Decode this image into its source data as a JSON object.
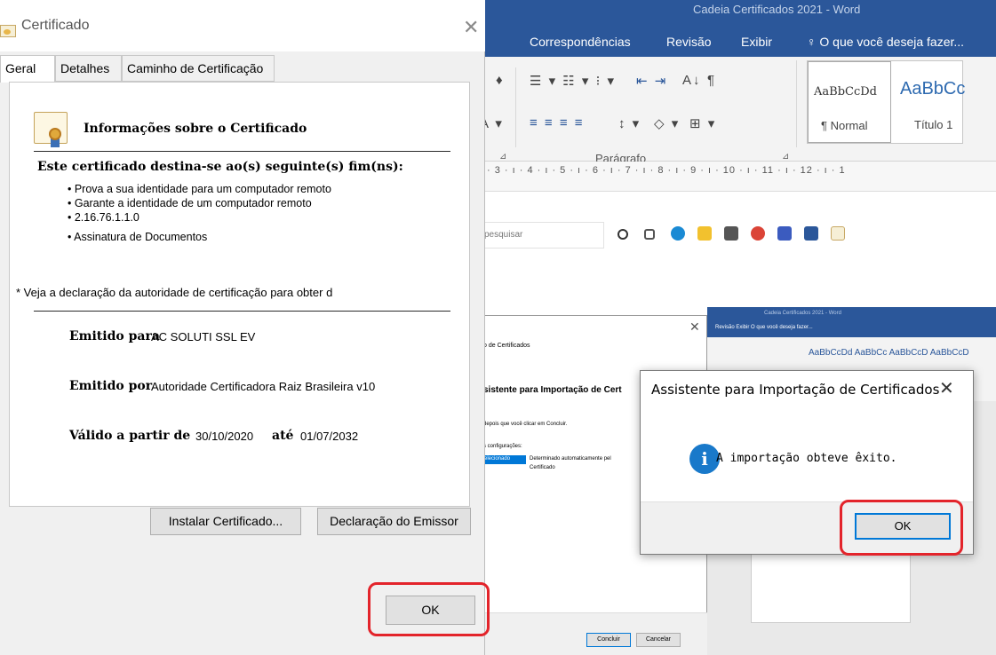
{
  "word": {
    "title": "Cadeia Certificados 2021 - Word",
    "menu": [
      "Correspondências",
      "Revisão",
      "Exibir"
    ],
    "tell_me": "O que você deseja fazer...",
    "ribbon_row1_glyphs": "☰ ▾ ☷ ▾ ⁝ ▾",
    "ribbon_row2_glyphs": "≡ ≡ ≡ ≡",
    "paragraph_group": "Parágrafo",
    "styles": [
      {
        "sample": "AaBbCcDd",
        "name": "¶ Normal"
      },
      {
        "sample": "AaBbCc",
        "name": "Título 1"
      }
    ],
    "ruler": "· 3 · ı · 4 · ı · 5 · ı · 6 · ı · 7 · ı · 8 · ı · 9 · ı · 10 · ı · 11 · ı · 12 · ı · 1",
    "taskbar_search": "pesquisar"
  },
  "inner_screenshot": {
    "word_title": "Cadeia Certificados 2021 - Word",
    "word_menu": "Revisão   Exibir   O que você deseja fazer...",
    "styles": "AaBbCcDd  AaBbCc  AaBbCcD  AaBbCcD",
    "wizard_subtitle": "o de Certificados",
    "wizard_title": "sistente para Importação de Cert",
    "wizard_hint": "depois que você clicar em Concluir.",
    "wizard_config": "s configurações:",
    "wizard_selected": "Selecionado",
    "wizard_detected": "Determinado automaticamente pel",
    "wizard_cert": "Certificado",
    "concluir": "Concluir",
    "cancelar": "Cancelar"
  },
  "success_dialog": {
    "title": "Assistente para Importação de Certificados",
    "close": "✕",
    "info_icon": "i",
    "message": "A importação obteve êxito.",
    "ok": "OK"
  },
  "cert_dialog": {
    "title": "Certificado",
    "close": "✕",
    "tabs": [
      "Geral",
      "Detalhes",
      "Caminho de Certificação"
    ],
    "info_heading": "Informações sobre o Certificado",
    "purpose_heading": "Este certificado destina-se ao(s) seguinte(s) fim(ns):",
    "purposes": [
      "• Prova a sua identidade para um computador remoto",
      "• Garante a identidade de um computador remoto",
      "• 2.16.76.1.1.0",
      "• Assinatura de Documentos"
    ],
    "disclaimer": "* Veja a declaração da autoridade de certificação para obter d",
    "issued_to_label": "Emitido para",
    "issued_to_value": "AC SOLUTI SSL EV",
    "issued_by_label": "Emitido por",
    "issued_by_value": "Autoridade Certificadora Raiz Brasileira v10",
    "valid_from_label": "Válido a partir de",
    "valid_from_value": "30/10/2020",
    "valid_to_label": "até",
    "valid_to_value": "01/07/2032",
    "install_button": "Instalar Certificado...",
    "declaration_button": "Declaração do Emissor",
    "ok": "OK"
  },
  "colors": {
    "word_blue": "#2b579a",
    "highlight_red": "#e3242b",
    "info_blue": "#1979ca",
    "focus_blue": "#0078d7"
  }
}
